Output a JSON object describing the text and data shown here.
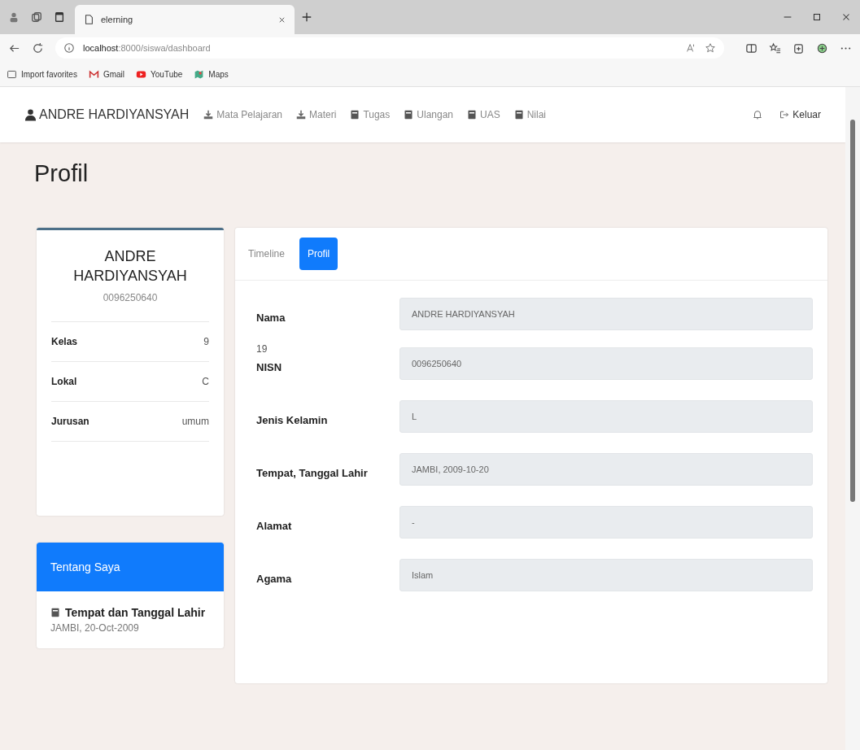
{
  "browser": {
    "tabs": [
      {
        "title": "elerning",
        "selected": true
      }
    ],
    "url_host": "localhost",
    "url_path": ":8000/siswa/dashboard",
    "bookmarks": [
      {
        "label": "Import favorites",
        "kind": "folder"
      },
      {
        "label": "Gmail",
        "kind": "gmail"
      },
      {
        "label": "YouTube",
        "kind": "youtube"
      },
      {
        "label": "Maps",
        "kind": "maps"
      }
    ]
  },
  "navbar": {
    "brand": "ANDRE HARDIYANSYAH",
    "items": [
      {
        "label": "Mata Pelajaran",
        "kind": "download"
      },
      {
        "label": "Materi",
        "kind": "download"
      },
      {
        "label": "Tugas",
        "kind": "book"
      },
      {
        "label": "Ulangan",
        "kind": "book"
      },
      {
        "label": "UAS",
        "kind": "book"
      },
      {
        "label": "Nilai",
        "kind": "book"
      }
    ],
    "logout": "Keluar"
  },
  "page_title": "Profil",
  "profile_card": {
    "name": "ANDRE HARDIYANSYAH",
    "id": "0096250640",
    "rows": [
      {
        "label": "Kelas",
        "value": "9"
      },
      {
        "label": "Lokal",
        "value": "C"
      },
      {
        "label": "Jurusan",
        "value": "umum"
      }
    ]
  },
  "about_card": {
    "title": "Tentang Saya",
    "items": [
      {
        "title": "Tempat dan Tanggal Lahir",
        "text": "JAMBI, 20-Oct-2009"
      }
    ]
  },
  "tabs": [
    {
      "label": "Timeline",
      "selected": false
    },
    {
      "label": "Profil",
      "selected": true
    }
  ],
  "form": [
    {
      "kind": "field",
      "label": "Nama",
      "value": "ANDRE HARDIYANSYAH"
    },
    {
      "kind": "text",
      "text": "19"
    },
    {
      "kind": "field",
      "label": "NISN",
      "value": "0096250640"
    },
    {
      "kind": "field",
      "label": "Jenis Kelamin",
      "value": "L"
    },
    {
      "kind": "field",
      "label": "Tempat, Tanggal Lahir",
      "value": "JAMBI, 2009-10-20"
    },
    {
      "kind": "field",
      "label": "Alamat",
      "value": "-"
    },
    {
      "kind": "field",
      "label": "Agama",
      "value": "Islam"
    }
  ]
}
